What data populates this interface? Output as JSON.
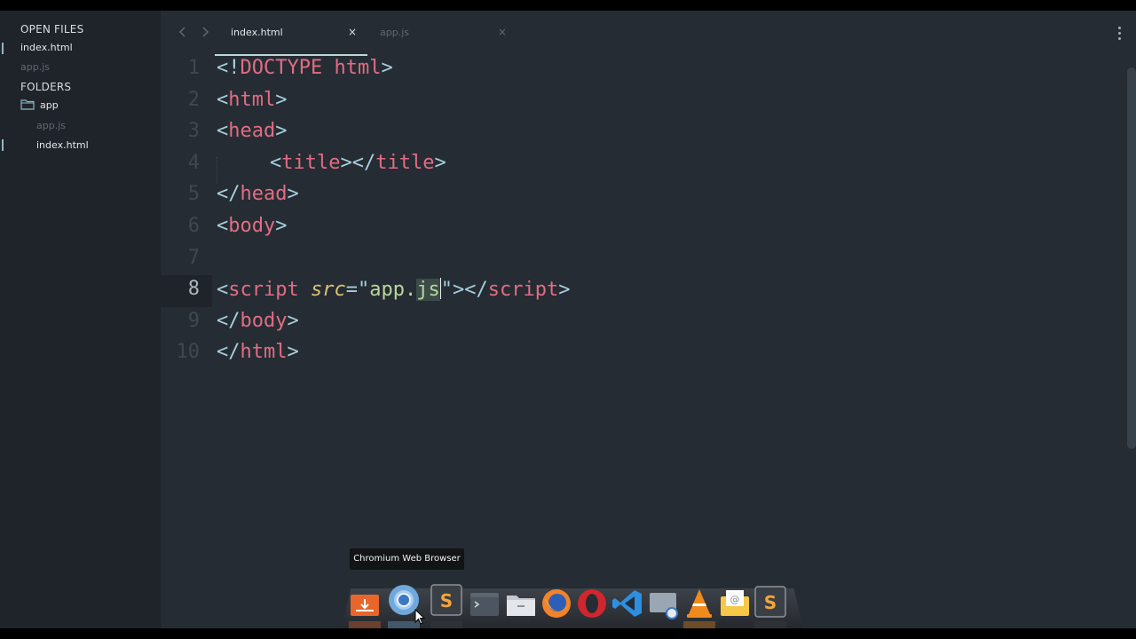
{
  "sidebar": {
    "open_files_header": "OPEN FILES",
    "open_files": [
      {
        "label": "index.html",
        "active": true
      },
      {
        "label": "app.js",
        "active": false
      }
    ],
    "folders_header": "FOLDERS",
    "folder": {
      "label": "app",
      "icon": "folder-icon",
      "children": [
        {
          "label": "app.js",
          "active": false
        },
        {
          "label": "index.html",
          "active": true
        }
      ]
    }
  },
  "tabs": [
    {
      "label": "index.html",
      "active": true,
      "close": "×"
    },
    {
      "label": "app.js",
      "active": false,
      "close": "×"
    }
  ],
  "editor": {
    "line_numbers": [
      "1",
      "2",
      "3",
      "4",
      "5",
      "6",
      "7",
      "8",
      "9",
      "10"
    ],
    "current_line": "8",
    "code": {
      "line1": {
        "open": "<!",
        "keyword": "DOCTYPE html",
        "close": ">"
      },
      "line2": {
        "open": "<",
        "tag": "html",
        "close": ">"
      },
      "line3": {
        "open": "<",
        "tag": "head",
        "close": ">"
      },
      "line4": {
        "open": "<",
        "tag": "title",
        "mid": "></",
        "tag2": "title",
        "close": ">"
      },
      "line5": {
        "open": "</",
        "tag": "head",
        "close": ">"
      },
      "line6": {
        "open": "<",
        "tag": "body",
        "close": ">"
      },
      "line7": "",
      "line8": {
        "open": "<",
        "tag": "script",
        "attr": "src",
        "eq": "=",
        "quote1": "\"",
        "str": "app.",
        "str_selected": "js",
        "quote2": "\"",
        "mid": "></",
        "tag2": "script",
        "close": ">"
      },
      "line9": {
        "open": "</",
        "tag": "body",
        "close": ">"
      },
      "line10": {
        "open": "</",
        "tag": "html",
        "close": ">"
      }
    }
  },
  "tooltip": {
    "text": "Chromium Web Browser"
  },
  "dock": {
    "apps": [
      {
        "name": "install-app-icon",
        "color": "#e8662a"
      },
      {
        "name": "chromium-icon",
        "color": "#6fa8dc"
      },
      {
        "name": "sublime-text-icon",
        "color": "#f3a53b",
        "glyph": "S"
      },
      {
        "name": "terminal-icon",
        "color": "#4c5560"
      },
      {
        "name": "files-icon",
        "color": "#d9dde2"
      },
      {
        "name": "firefox-icon",
        "color": "#f0832b"
      },
      {
        "name": "opera-icon",
        "color": "#d0262d"
      },
      {
        "name": "vscode-icon",
        "color": "#2d8fe0"
      },
      {
        "name": "screenshot-icon",
        "color": "#9aa6b1"
      },
      {
        "name": "vlc-icon",
        "color": "#f08a1c"
      },
      {
        "name": "mail-icon",
        "color": "#f6c846",
        "glyph": "@"
      },
      {
        "name": "sublime-text-2-icon",
        "color": "#f3a53b",
        "glyph": "S"
      }
    ]
  },
  "colors": {
    "sidebar_bg": "#1f242a",
    "editor_bg": "#262c33",
    "tag": "#e16d84",
    "punctuation": "#a6d0de",
    "attribute": "#dcc276",
    "string": "#b9d79c"
  }
}
